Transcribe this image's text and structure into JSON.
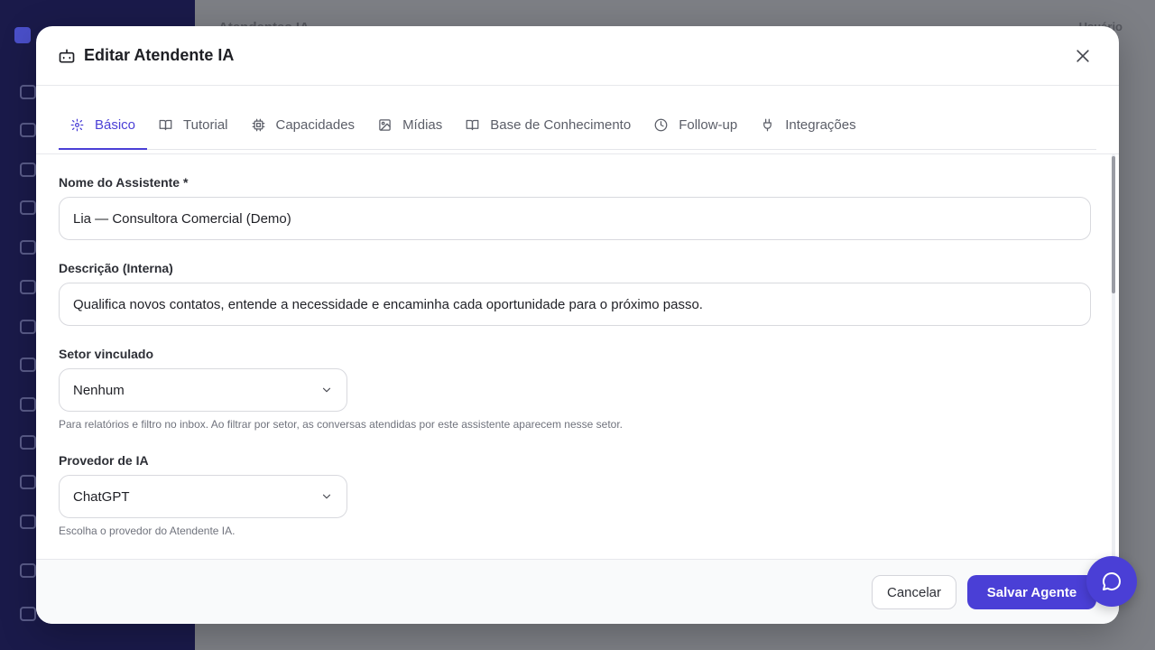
{
  "background": {
    "page_title": "Atendentes IA",
    "user_label": "Usuário"
  },
  "modal": {
    "title": "Editar Atendente IA",
    "title_icon": "bot-icon",
    "close_icon": "close-icon"
  },
  "tabs": [
    {
      "label": "Básico",
      "icon": "gear-icon",
      "active": true
    },
    {
      "label": "Tutorial",
      "icon": "book-icon",
      "active": false
    },
    {
      "label": "Capacidades",
      "icon": "chip-icon",
      "active": false
    },
    {
      "label": "Mídias",
      "icon": "image-icon",
      "active": false
    },
    {
      "label": "Base de Conhecimento",
      "icon": "book-open-icon",
      "active": false
    },
    {
      "label": "Follow-up",
      "icon": "clock-icon",
      "active": false
    },
    {
      "label": "Integrações",
      "icon": "plug-icon",
      "active": false
    }
  ],
  "form": {
    "name": {
      "label": "Nome do Assistente *",
      "value": "Lia — Consultora Comercial (Demo)"
    },
    "description": {
      "label": "Descrição (Interna)",
      "value": "Qualifica novos contatos, entende a necessidade e encaminha cada oportunidade para o próximo passo."
    },
    "sector": {
      "label": "Setor vinculado",
      "value": "Nenhum",
      "helper": "Para relatórios e filtro no inbox. Ao filtrar por setor, as conversas atendidas por este assistente aparecem nesse setor."
    },
    "provider": {
      "label": "Provedor de IA",
      "value": "ChatGPT",
      "helper": "Escolha o provedor do Atendente IA."
    }
  },
  "footer": {
    "cancel_label": "Cancelar",
    "save_label": "Salvar Agente"
  },
  "chat_fab_icon": "chat-bubble-icon",
  "colors": {
    "accent": "#4a3fd6",
    "sidebar": "#1a1a4a"
  }
}
